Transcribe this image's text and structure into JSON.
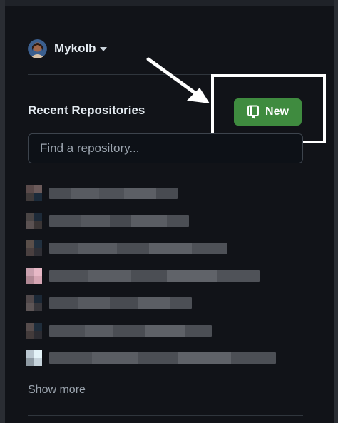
{
  "user": {
    "name": "Mykolb"
  },
  "recent_repositories": {
    "title": "Recent Repositories",
    "new_button_label": "New",
    "search_placeholder": "Find a repository...",
    "show_more_label": "Show more"
  },
  "colors": {
    "new_button": "#3f8b3f",
    "highlight_box": "#ffffff",
    "background": "#111318"
  },
  "icons": {
    "new_button": "repo-icon",
    "dropdown": "caret-down-icon",
    "annotation": "arrow-icon"
  }
}
